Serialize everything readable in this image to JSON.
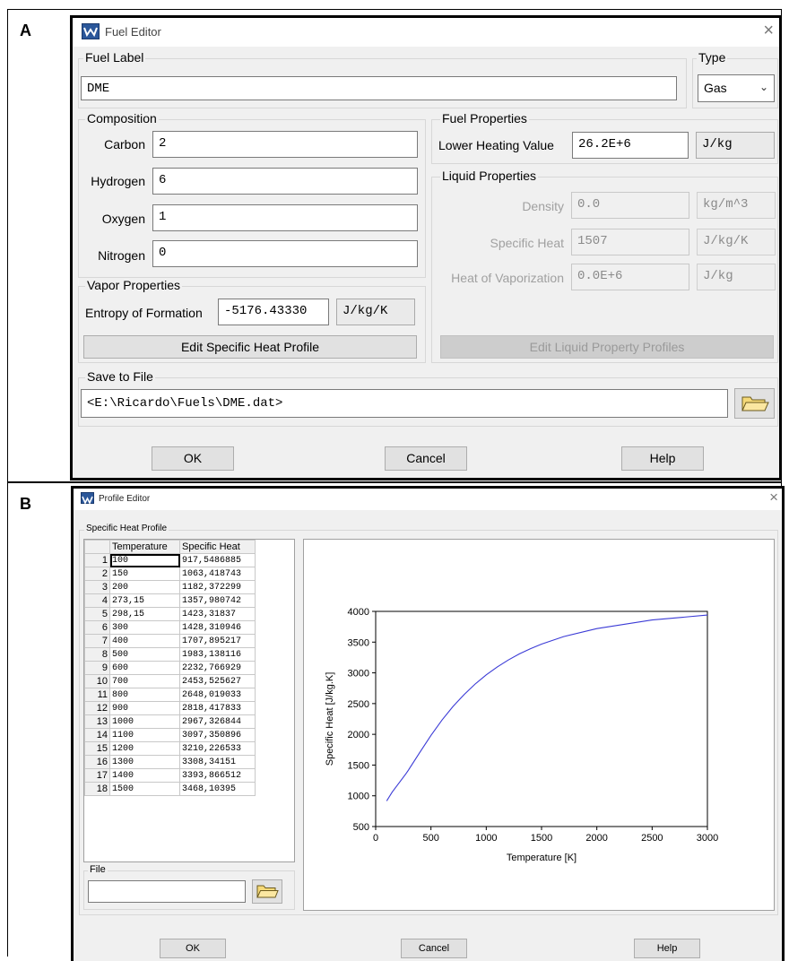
{
  "panel_a": {
    "letter": "A",
    "window_title": "Fuel Editor",
    "close_glyph": "×",
    "fuel_label": {
      "title": "Fuel Label",
      "value": "DME"
    },
    "type": {
      "title": "Type",
      "value": "Gas"
    },
    "composition": {
      "title": "Composition",
      "rows": [
        {
          "label": "Carbon",
          "value": "2"
        },
        {
          "label": "Hydrogen",
          "value": "6"
        },
        {
          "label": "Oxygen",
          "value": "1"
        },
        {
          "label": "Nitrogen",
          "value": "0"
        }
      ]
    },
    "fuel_properties": {
      "title": "Fuel Properties",
      "label": "Lower Heating Value",
      "value": "26.2E+6",
      "unit": "J/kg"
    },
    "liquid_properties": {
      "title": "Liquid Properties",
      "rows": [
        {
          "label": "Density",
          "value": "0.0",
          "unit": "kg/m^3"
        },
        {
          "label": "Specific Heat",
          "value": "1507",
          "unit": "J/kg/K"
        },
        {
          "label": "Heat of Vaporization",
          "value": "0.0E+6",
          "unit": "J/kg"
        }
      ]
    },
    "vapor_properties": {
      "title": "Vapor Properties",
      "label": "Entropy of Formation",
      "value": "-5176.43330",
      "unit": "J/kg/K"
    },
    "edit_specific_heat_button": "Edit Specific Heat Profile",
    "edit_liquid_button": "Edit Liquid Property Profiles",
    "save_to_file": {
      "title": "Save to File",
      "value": "<E:\\Ricardo\\Fuels\\DME.dat>"
    },
    "buttons": {
      "ok": "OK",
      "cancel": "Cancel",
      "help": "Help"
    }
  },
  "panel_b": {
    "letter": "B",
    "window_title": "Profile Editor",
    "close_glyph": "×",
    "group_title": "Specific Heat Profile",
    "table": {
      "headers": [
        "Temperature",
        "Specific Heat"
      ],
      "rows": [
        [
          "1",
          "100",
          "917,5486885"
        ],
        [
          "2",
          "150",
          "1063,418743"
        ],
        [
          "3",
          "200",
          "1182,372299"
        ],
        [
          "4",
          "273,15",
          "1357,980742"
        ],
        [
          "5",
          "298,15",
          "1423,31837"
        ],
        [
          "6",
          "300",
          "1428,310946"
        ],
        [
          "7",
          "400",
          "1707,895217"
        ],
        [
          "8",
          "500",
          "1983,138116"
        ],
        [
          "9",
          "600",
          "2232,766929"
        ],
        [
          "10",
          "700",
          "2453,525627"
        ],
        [
          "11",
          "800",
          "2648,019033"
        ],
        [
          "12",
          "900",
          "2818,417833"
        ],
        [
          "13",
          "1000",
          "2967,326844"
        ],
        [
          "14",
          "1100",
          "3097,350896"
        ],
        [
          "15",
          "1200",
          "3210,226533"
        ],
        [
          "16",
          "1300",
          "3308,34151"
        ],
        [
          "17",
          "1400",
          "3393,866512"
        ],
        [
          "18",
          "1500",
          "3468,10395"
        ]
      ]
    },
    "file": {
      "title": "File",
      "value": ""
    },
    "buttons": {
      "ok": "OK",
      "cancel": "Cancel",
      "help": "Help"
    }
  },
  "chart_data": {
    "type": "line",
    "title": "",
    "xlabel": "Temperature  [K]",
    "ylabel": "Specific Heat  [J/kg.K]",
    "xlim": [
      0,
      3000
    ],
    "ylim": [
      500,
      4000
    ],
    "xticks": [
      0,
      500,
      1000,
      1500,
      2000,
      2500,
      3000
    ],
    "yticks": [
      500,
      1000,
      1500,
      2000,
      2500,
      3000,
      3500,
      4000
    ],
    "grid": false,
    "line_color": "#3b3bd6",
    "x": [
      100,
      150,
      200,
      273.15,
      298.15,
      300,
      400,
      500,
      600,
      700,
      800,
      900,
      1000,
      1100,
      1200,
      1300,
      1400,
      1500,
      1700,
      2000,
      2500,
      3000
    ],
    "y": [
      917.5,
      1063.4,
      1182.4,
      1358.0,
      1423.3,
      1428.3,
      1707.9,
      1983.1,
      2232.8,
      2453.5,
      2648.0,
      2818.4,
      2967.3,
      3097.4,
      3210.2,
      3308.3,
      3393.9,
      3468.1,
      3590,
      3720,
      3860,
      3940
    ]
  }
}
